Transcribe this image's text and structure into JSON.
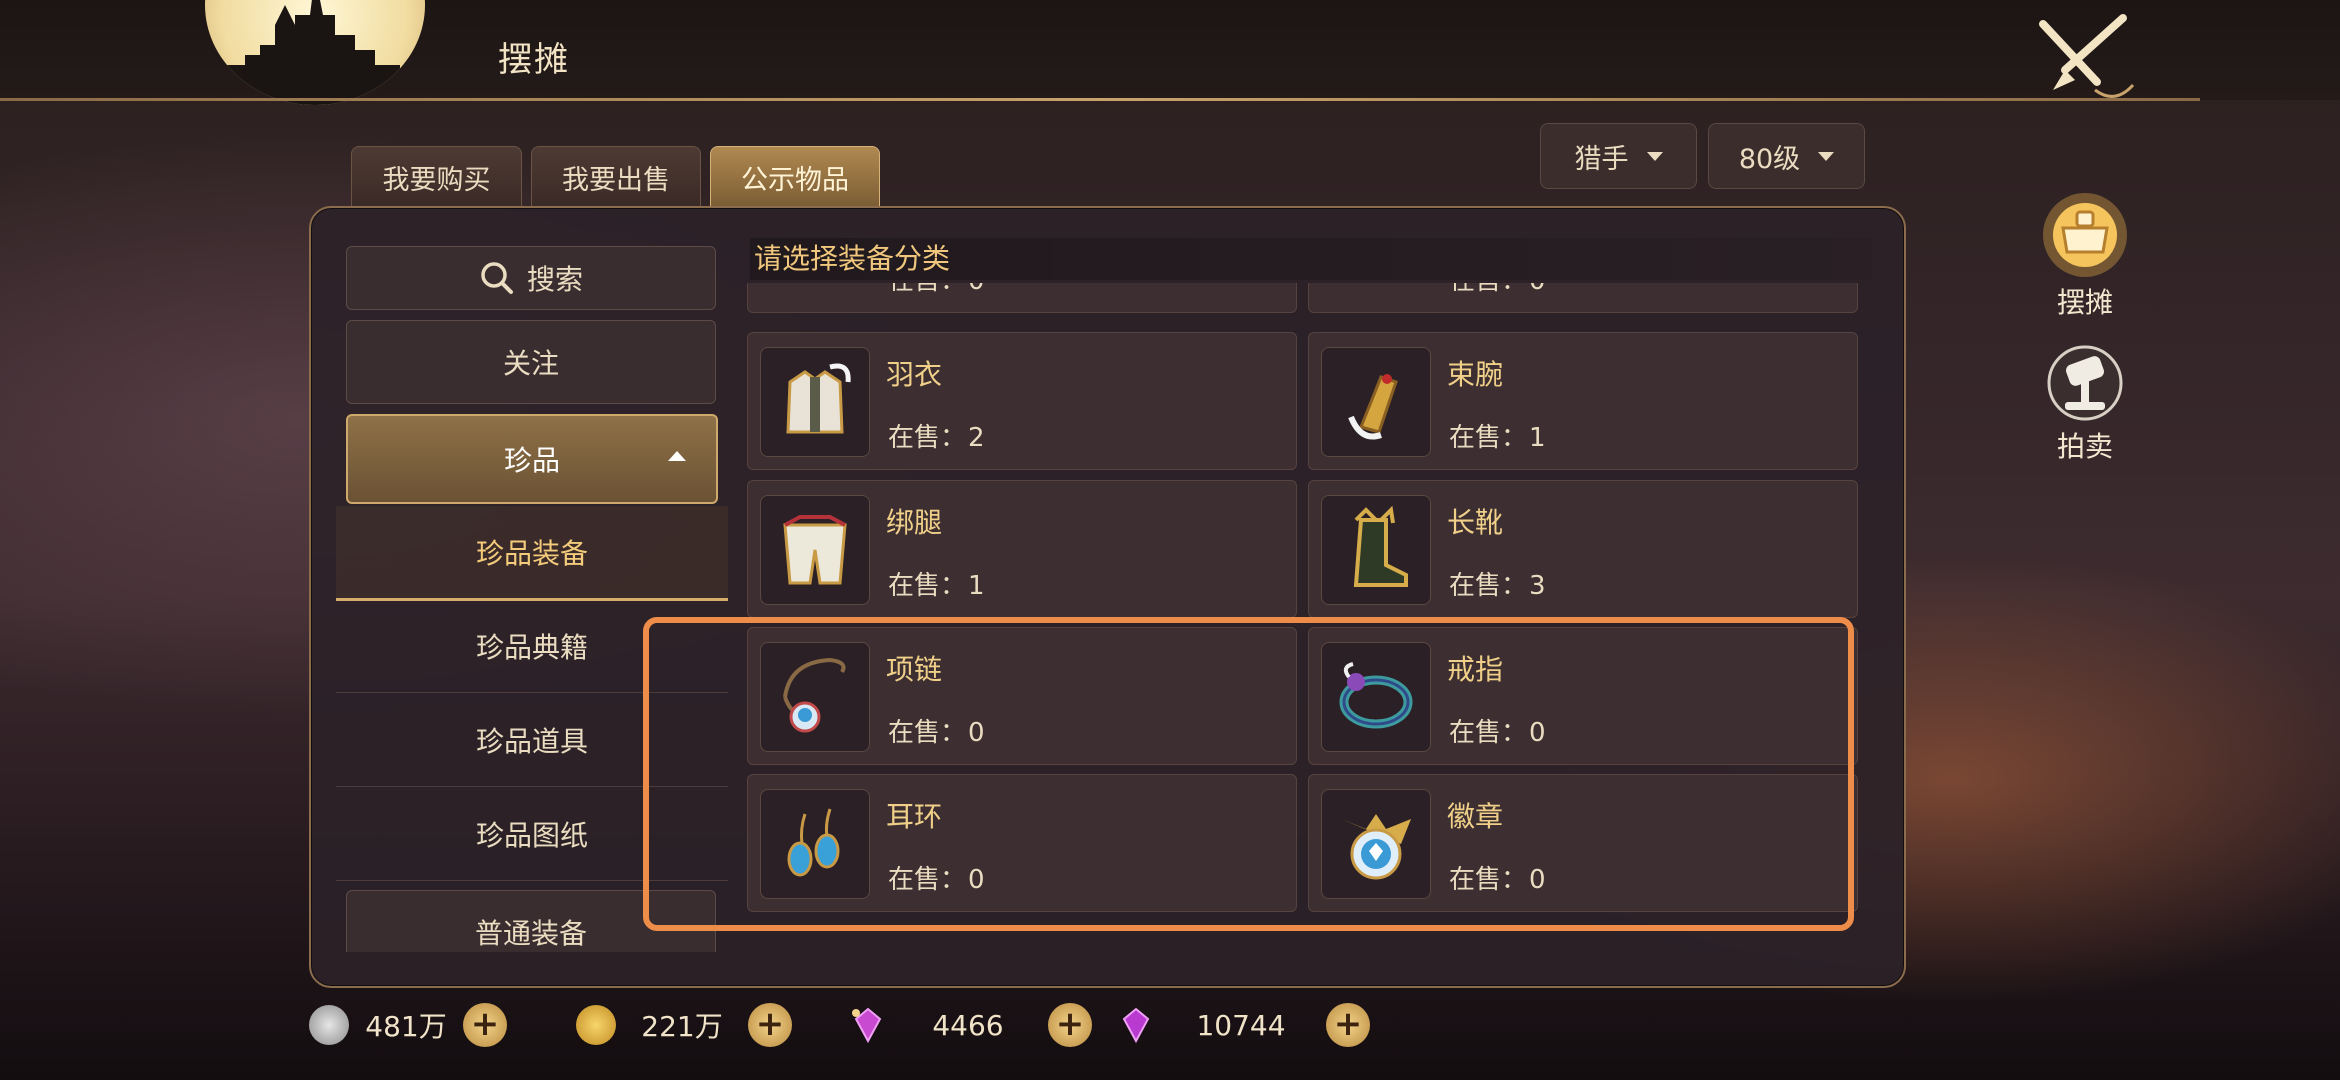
{
  "header": {
    "title": "摆摊"
  },
  "tabs": [
    {
      "label": "我要购买",
      "active": false
    },
    {
      "label": "我要出售",
      "active": false
    },
    {
      "label": "公示物品",
      "active": true
    }
  ],
  "filters": {
    "class_label": "猎手",
    "level_label": "80级"
  },
  "sidebar": {
    "search_label": "搜索",
    "follow_label": "关注",
    "treasure_label": "珍品",
    "sub_items": [
      {
        "label": "珍品装备",
        "active": true
      },
      {
        "label": "珍品典籍",
        "active": false
      },
      {
        "label": "珍品道具",
        "active": false
      },
      {
        "label": "珍品图纸",
        "active": false
      }
    ],
    "normal_label": "普通装备"
  },
  "content": {
    "title": "请选择装备分类",
    "stock_prefix": "在售：",
    "partial_top": [
      {
        "stock": "0"
      },
      {
        "stock": "0"
      }
    ],
    "items": [
      {
        "name": "羽衣",
        "stock": "2",
        "icon": "robe-icon"
      },
      {
        "name": "束腕",
        "stock": "1",
        "icon": "bracer-icon"
      },
      {
        "name": "绑腿",
        "stock": "1",
        "icon": "leggings-icon"
      },
      {
        "name": "长靴",
        "stock": "3",
        "icon": "boots-icon"
      },
      {
        "name": "项链",
        "stock": "0",
        "icon": "necklace-icon"
      },
      {
        "name": "戒指",
        "stock": "0",
        "icon": "ring-icon"
      },
      {
        "name": "耳环",
        "stock": "0",
        "icon": "earring-icon"
      },
      {
        "name": "徽章",
        "stock": "0",
        "icon": "badge-icon"
      }
    ]
  },
  "right_menu": [
    {
      "label": "摆摊",
      "icon": "stall-icon",
      "active": true
    },
    {
      "label": "拍卖",
      "icon": "auction-icon",
      "active": false
    }
  ],
  "currency": [
    {
      "value": "481万",
      "icon": "silver-coin-icon"
    },
    {
      "value": "221万",
      "icon": "gold-coin-icon"
    },
    {
      "value": "4466",
      "icon": "bound-crystal-icon"
    },
    {
      "value": "10744",
      "icon": "crystal-icon"
    }
  ],
  "colors": {
    "accent": "#f0c77c",
    "highlight_frame": "#ee8c4a",
    "panel_border": "#8b6c4c"
  }
}
